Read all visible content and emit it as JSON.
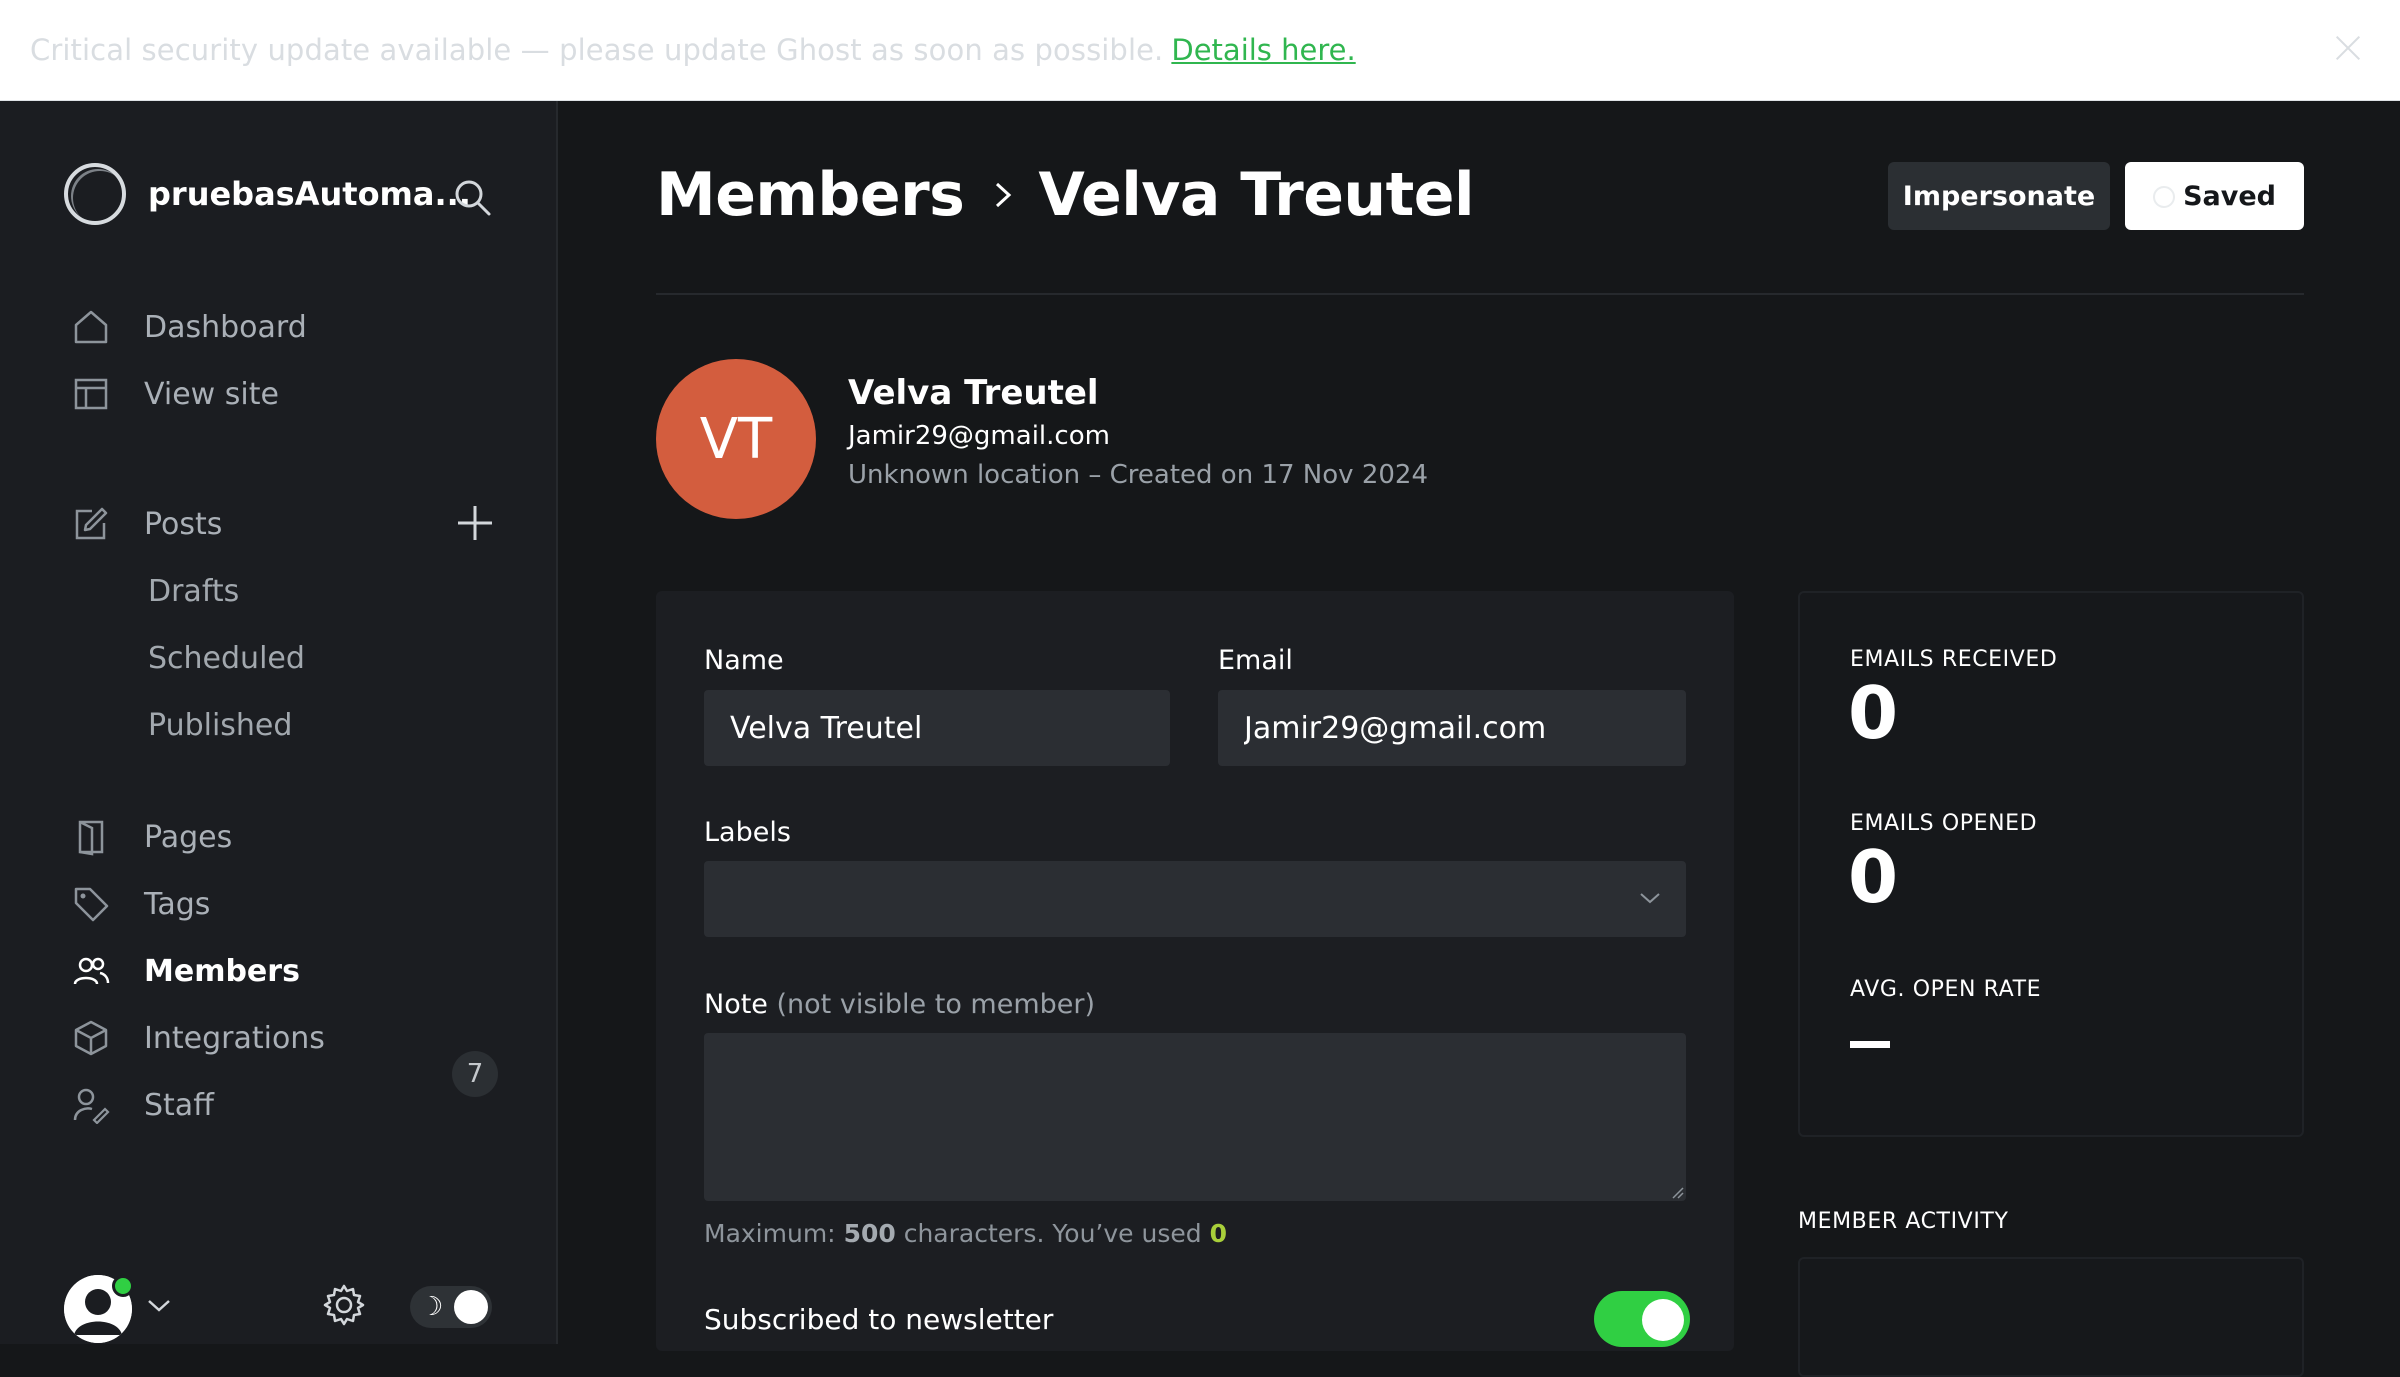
{
  "banner": {
    "text": "Critical security update available — please update Ghost as soon as possible.",
    "link": "Details here."
  },
  "sidebar": {
    "site_name": "pruebasAutoma...",
    "nav": {
      "dashboard": "Dashboard",
      "view_site": "View site",
      "posts": "Posts",
      "drafts": "Drafts",
      "scheduled": "Scheduled",
      "published": "Published",
      "pages": "Pages",
      "tags": "Tags",
      "members": "Members",
      "members_count": "7",
      "integrations": "Integrations",
      "staff": "Staff"
    },
    "active_item": "Members"
  },
  "header": {
    "breadcrumb_parent": "Members",
    "breadcrumb_current": "Velva Treutel",
    "impersonate_label": "Impersonate",
    "saved_label": "Saved"
  },
  "member": {
    "initials": "VT",
    "name": "Velva Treutel",
    "email": "Jamir29@gmail.com",
    "meta": "Unknown location – Created on 17 Nov 2024",
    "avatar_color": "#d35d3e"
  },
  "form": {
    "name_label": "Name",
    "name_value": "Velva Treutel",
    "email_label": "Email",
    "email_value": "Jamir29@gmail.com",
    "labels_label": "Labels",
    "labels_value": "",
    "note_label": "Note",
    "note_hint": "(not visible to member)",
    "note_value": "",
    "count_prefix": "Maximum:",
    "count_max": "500",
    "count_mid": "characters. You’ve used",
    "count_used": "0",
    "newsletter_label": "Subscribed to newsletter",
    "newsletter_subscribed": true
  },
  "stats": {
    "emails_received_label": "EMAILS RECEIVED",
    "emails_received_value": "0",
    "emails_opened_label": "EMAILS OPENED",
    "emails_opened_value": "0",
    "avg_open_rate_label": "AVG. OPEN RATE",
    "activity_label": "MEMBER ACTIVITY"
  },
  "colors": {
    "accent_green": "#30cf43",
    "link_green": "#30b64f",
    "used_count": "#a8cf3a"
  }
}
